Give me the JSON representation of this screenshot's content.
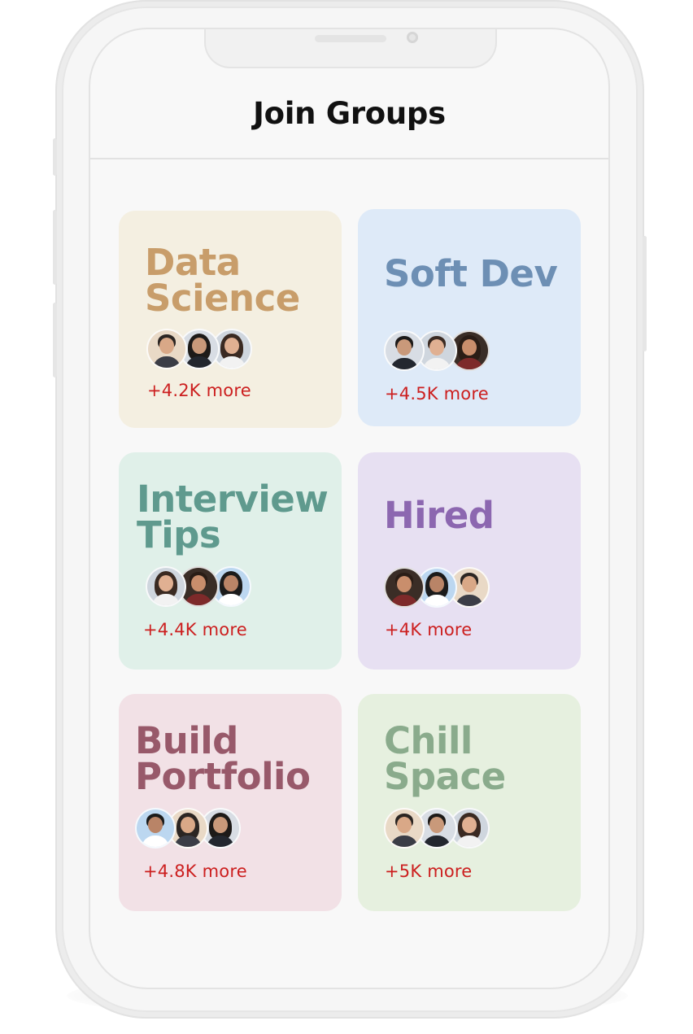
{
  "header": {
    "title": "Join Groups"
  },
  "colors": {
    "more_text": "#cc1f1f"
  },
  "groups": [
    {
      "name": "Data Science",
      "more": "+4.2K more",
      "bg": "#f4efe1",
      "fg": "#c89d6a",
      "avatars": [
        "man-avatar",
        "woman-avatar",
        "woman-avatar"
      ]
    },
    {
      "name": "Soft Dev",
      "more": "+4.5K more",
      "bg": "#deeaf8",
      "fg": "#6d8fb4",
      "avatars": [
        "man-avatar",
        "man-avatar",
        "woman-avatar"
      ]
    },
    {
      "name": "Interview Tips",
      "more": "+4.4K more",
      "bg": "#e0f0e9",
      "fg": "#5f9a8e",
      "avatars": [
        "woman-avatar",
        "man-avatar",
        "woman-avatar"
      ]
    },
    {
      "name": "Hired",
      "more": "+4K more",
      "bg": "#e7e0f2",
      "fg": "#8c67b0",
      "avatars": [
        "man-avatar",
        "woman-avatar",
        "man-avatar"
      ]
    },
    {
      "name": "Build Portfolio",
      "more": "+4.8K more",
      "bg": "#f2e1e6",
      "fg": "#98596a",
      "avatars": [
        "man-avatar",
        "woman-avatar",
        "woman-avatar"
      ]
    },
    {
      "name": "Chill Space",
      "more": "+5K more",
      "bg": "#e6f0df",
      "fg": "#8aab8c",
      "avatars": [
        "man-avatar",
        "man-avatar",
        "woman-avatar"
      ]
    }
  ]
}
